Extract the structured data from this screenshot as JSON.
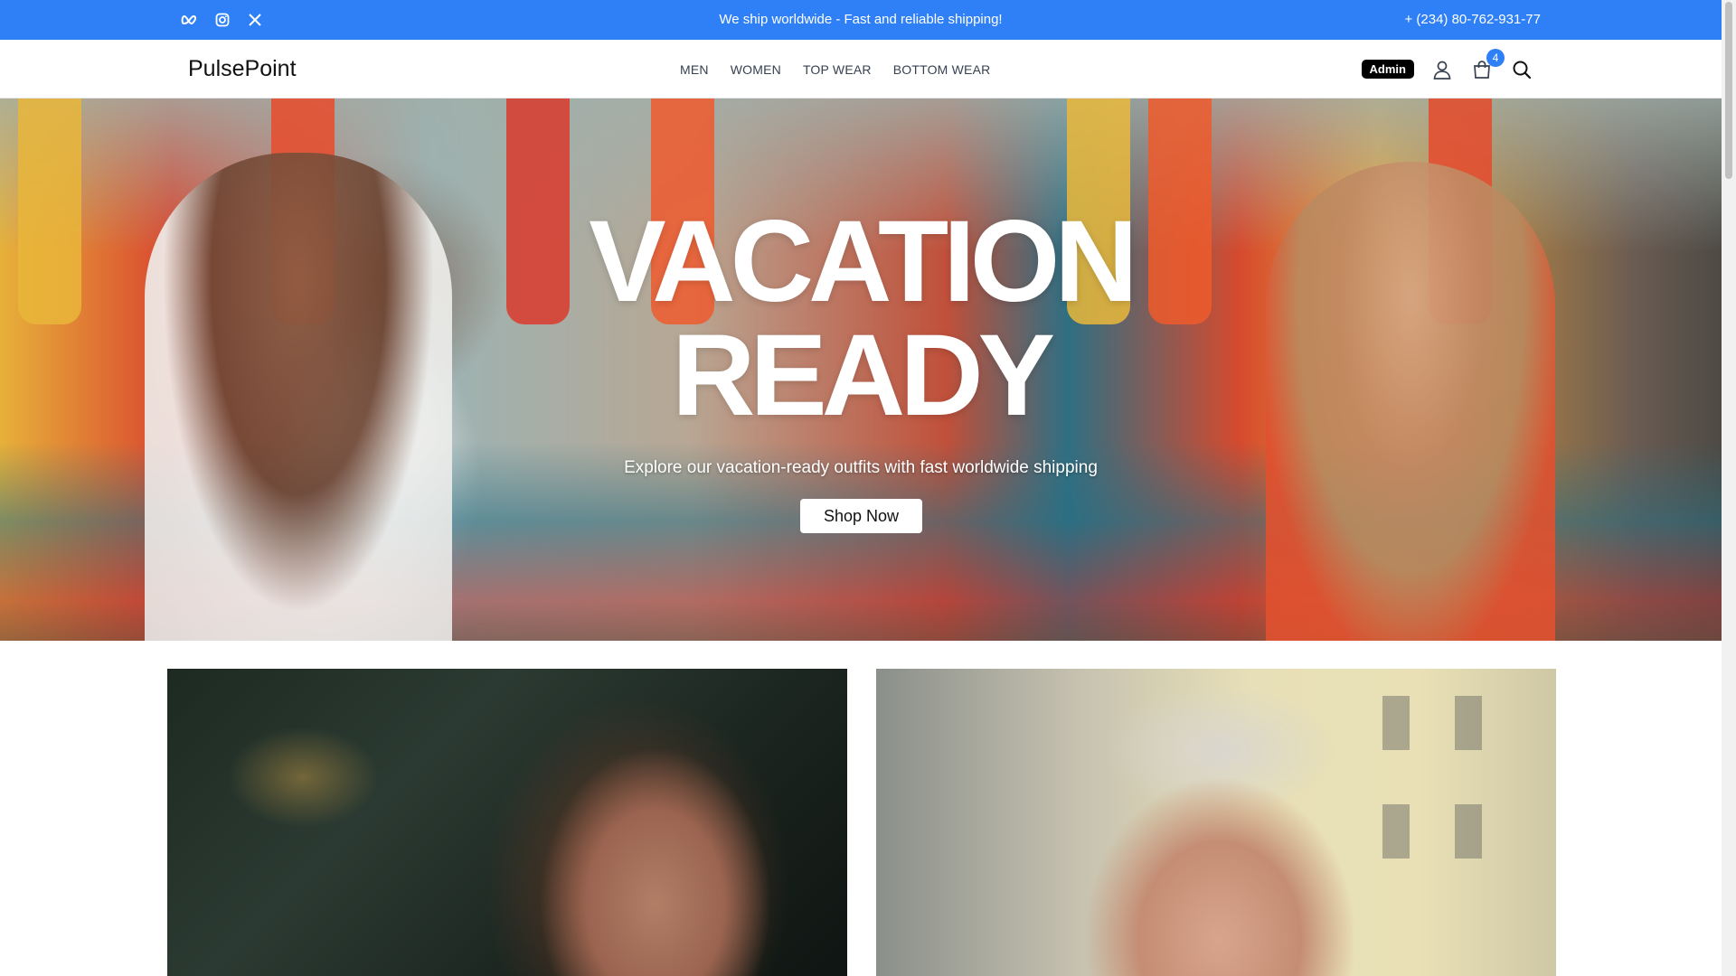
{
  "topbar": {
    "announcement": "We ship worldwide - Fast and reliable shipping!",
    "phone": "+ (234) 80-762-931-77",
    "socials": [
      "meta-icon",
      "instagram-icon",
      "x-icon"
    ],
    "background": "#2f80f7"
  },
  "header": {
    "logo": "PulsePoint",
    "nav": [
      "MEN",
      "WOMEN",
      "TOP WEAR",
      "BOTTOM WEAR"
    ],
    "admin_label": "Admin",
    "cart_count": "4",
    "icons": [
      "user-icon",
      "cart-icon",
      "search-icon"
    ]
  },
  "hero": {
    "title_line1": "VACATION",
    "title_line2": "READY",
    "subtitle": "Explore our vacation-ready outfits with fast worldwide shipping",
    "cta": "Shop Now"
  },
  "collections": [
    "womens-collection-image",
    "mens-collection-image"
  ]
}
